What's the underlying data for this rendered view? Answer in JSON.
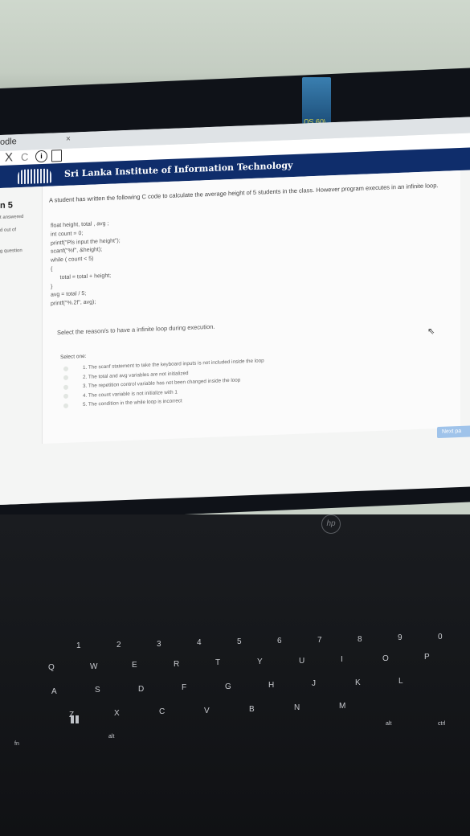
{
  "browser": {
    "tab_title": "odle",
    "tab_close": "×",
    "nav_close": "X",
    "nav_reload": "C"
  },
  "site": {
    "title": "Sri Lanka Institute of Information Technology"
  },
  "sidebar": {
    "question_number": "n 5",
    "status": "t answered",
    "mark": "d out of",
    "flag": "g question"
  },
  "question": {
    "text": "A student has written the following C code to calculate the average height of 5 students in the class. However program executes in an infinite loop.",
    "code_lines": [
      "float height, total , avg ;",
      "int count = 0;",
      "printf(\"Pls input the height\");",
      "scanf(\"%f\", &height);",
      "while ( count < 5)",
      "{",
      "      total = total + height;",
      "}",
      "avg = total / 5;",
      "printf(\"%.2f\", avg);"
    ],
    "prompt": "Select the reason/s to have a infinite loop during execution.",
    "select_label": "Select one:",
    "options": [
      "1. The scanf statement to take the keyboard inputs is not included inside the loop",
      "2. The total and avg variables are not initialized",
      "3. The repetition control variable has not been changed inside the loop",
      "4. The count variable is not initialize with 1",
      "5. The condition in the while loop is incorrect"
    ]
  },
  "next_button": "Next pa",
  "sticker_text": "\\09 SU",
  "laptop_brand": "hp",
  "keyboard": {
    "row_numbers": [
      "1",
      "2",
      "3",
      "4",
      "5",
      "6",
      "7",
      "8",
      "9",
      "0"
    ],
    "row_q": [
      "Q",
      "W",
      "E",
      "R",
      "T",
      "Y",
      "U",
      "I",
      "O",
      "P"
    ],
    "row_a": [
      "A",
      "S",
      "D",
      "F",
      "G",
      "H",
      "J",
      "K",
      "L"
    ],
    "row_z": [
      "Z",
      "X",
      "C",
      "V",
      "B",
      "N",
      "M"
    ],
    "alt_left": "alt",
    "alt_right": "alt",
    "fn": "fn",
    "ctrl_right": "ctrl"
  }
}
